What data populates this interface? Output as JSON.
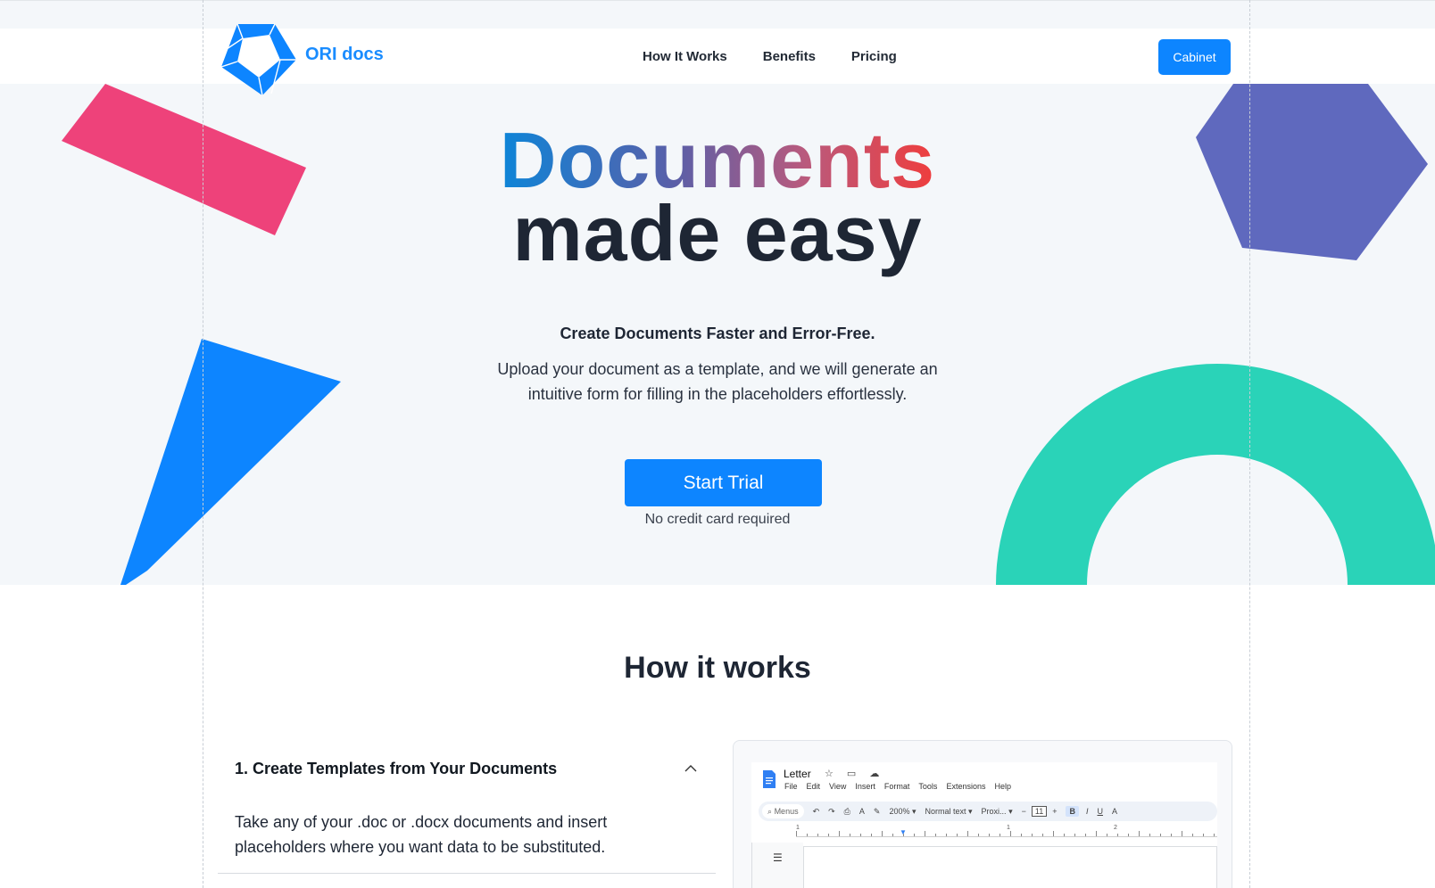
{
  "colors": {
    "accent": "#0d85ff",
    "pink_shape": "#ee427a",
    "purple_shape": "#5f69be",
    "blue_shape": "#0d85ff",
    "teal_shape": "#2ad3b8",
    "hero_bg": "#f4f7fa"
  },
  "header": {
    "brand": "ORI docs",
    "logo_icon": "ori-pentagon-logo",
    "nav": [
      "How It Works",
      "Benefits",
      "Pricing"
    ],
    "cabinet_label": "Cabinet"
  },
  "hero": {
    "title_line1": "Documents",
    "title_line2": "made easy",
    "subtitle": "Create Documents Faster and Error-Free.",
    "description": "Upload your document as a template, and we will generate an intuitive form for filling in the placeholders effortlessly.",
    "cta_label": "Start Trial",
    "cta_note": "No credit card required"
  },
  "how_it_works": {
    "heading": "How it works",
    "steps": [
      {
        "title": "1. Create Templates from Your Documents",
        "body": "Take any of your .doc or .docx documents and insert placeholders where you want data to be substituted.",
        "expanded": true,
        "icon": "chevron-up-icon"
      }
    ]
  },
  "preview": {
    "doc_title": "Letter",
    "title_icons": "☆ ▭ ☁",
    "menu": [
      "File",
      "Edit",
      "View",
      "Insert",
      "Format",
      "Tools",
      "Extensions",
      "Help"
    ],
    "toolbar": {
      "search": "Menus",
      "zoom": "200%",
      "style": "Normal text",
      "font": "Proxi...",
      "font_size": "11",
      "bold": "B",
      "italic": "I",
      "underline": "U"
    },
    "ruler_numbers": [
      "1",
      "1",
      "2"
    ]
  }
}
